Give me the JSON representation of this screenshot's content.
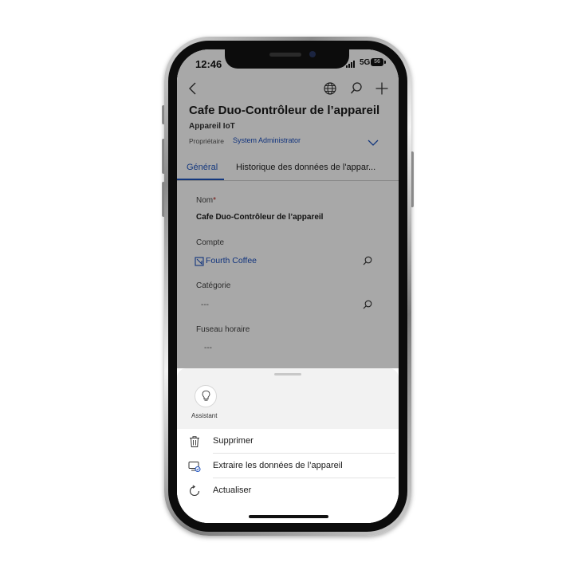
{
  "status_bar": {
    "time": "12:46",
    "network": "5G",
    "battery": "56"
  },
  "header": {
    "title": "Cafe Duo-Contrôleur de l’appareil",
    "entity_type": "Appareil IoT",
    "owner_label": "Propriétaire",
    "owner_value": "System Administrator"
  },
  "tabs": [
    {
      "label": "Général",
      "active": true
    },
    {
      "label": "Historique des données de l'appar..."
    }
  ],
  "form": {
    "name_label": "Nom",
    "required_marker": "*",
    "name_value": "Cafe Duo-Contrôleur de l’appareil",
    "account_label": "Compte",
    "account_value": "Fourth Coffee",
    "category_label": "Catégorie",
    "category_value": "---",
    "timezone_label": "Fuseau horaire",
    "timezone_value": "---"
  },
  "sheet": {
    "assistant_label": "Assistant",
    "items": [
      {
        "label": "Supprimer",
        "icon": "trash-icon"
      },
      {
        "label": "Extraire les données de l’appareil",
        "icon": "device-data-icon"
      },
      {
        "label": "Actualiser",
        "icon": "refresh-icon"
      }
    ]
  },
  "colors": {
    "accent": "#1f55c0",
    "link": "#1b4fbe",
    "required": "#b3261e"
  }
}
